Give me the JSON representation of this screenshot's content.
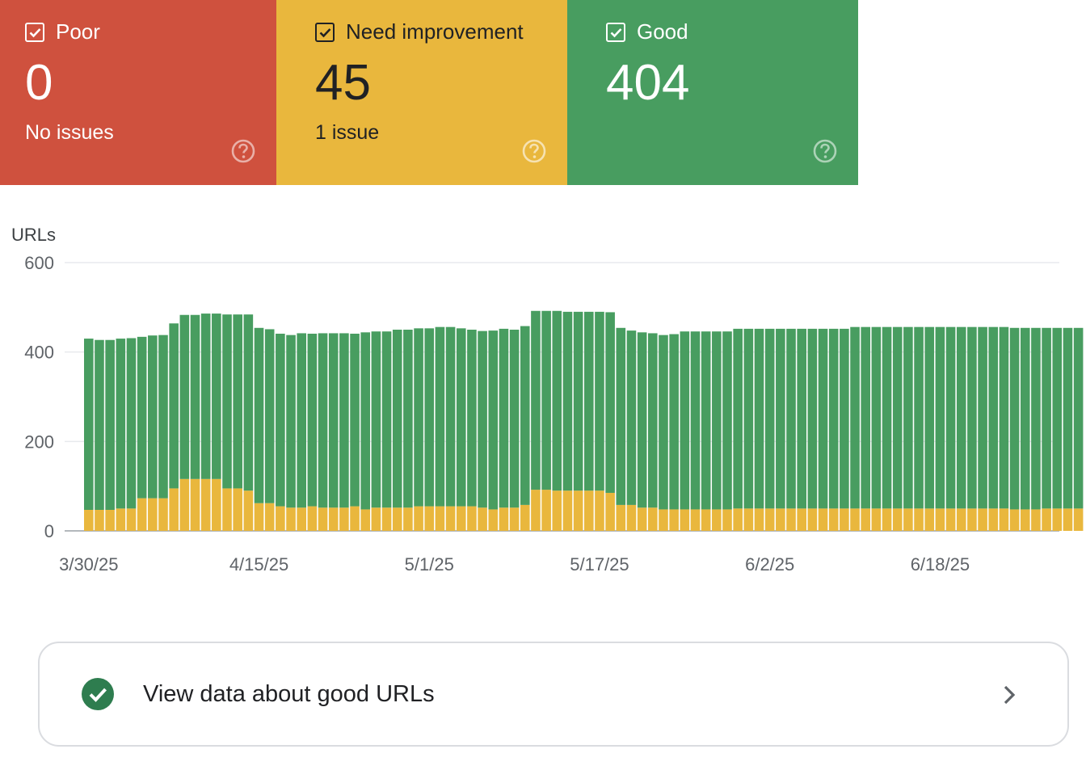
{
  "cards": {
    "poor": {
      "label": "Poor",
      "value": "0",
      "sub": "No issues",
      "color": "#cf513e"
    },
    "need_improvement": {
      "label": "Need improvement",
      "value": "45",
      "sub": "1 issue",
      "color": "#e9b73d"
    },
    "good": {
      "label": "Good",
      "value": "404",
      "sub": "",
      "color": "#489d60"
    }
  },
  "chart_data": {
    "type": "bar",
    "stacked": true,
    "ylabel": "URLs",
    "ylim": [
      0,
      600
    ],
    "yticks": [
      0,
      200,
      400,
      600
    ],
    "xtick_labels": [
      "3/30/25",
      "4/15/25",
      "5/1/25",
      "5/17/25",
      "6/2/25",
      "6/18/25"
    ],
    "xtick_index": [
      0,
      16,
      32,
      48,
      64,
      80
    ],
    "grid": true,
    "legend": "none",
    "series": [
      {
        "name": "Need improvement",
        "color": "#e9b73d",
        "values": [
          47,
          47,
          47,
          50,
          50,
          73,
          73,
          73,
          95,
          116,
          116,
          116,
          116,
          95,
          95,
          90,
          62,
          62,
          55,
          52,
          52,
          55,
          52,
          52,
          52,
          55,
          48,
          52,
          52,
          52,
          52,
          55,
          55,
          55,
          55,
          55,
          55,
          52,
          48,
          52,
          52,
          58,
          92,
          92,
          90,
          90,
          90,
          90,
          90,
          85,
          58,
          58,
          52,
          52,
          48,
          48,
          48,
          48,
          48,
          48,
          48,
          50,
          50,
          50,
          50,
          50,
          50,
          50,
          50,
          50,
          50,
          50,
          50,
          50,
          50,
          50,
          50,
          50,
          50,
          50,
          50,
          50,
          50,
          50,
          50,
          50,
          50,
          48,
          48,
          48,
          50,
          50,
          50,
          50
        ]
      },
      {
        "name": "Good",
        "color": "#489d60",
        "values": [
          383,
          380,
          380,
          380,
          381,
          361,
          364,
          365,
          369,
          367,
          367,
          370,
          370,
          389,
          389,
          394,
          392,
          389,
          386,
          386,
          390,
          386,
          390,
          390,
          390,
          386,
          396,
          394,
          394,
          398,
          398,
          398,
          398,
          401,
          401,
          398,
          395,
          395,
          400,
          400,
          398,
          400,
          400,
          400,
          402,
          400,
          400,
          400,
          400,
          404,
          396,
          390,
          392,
          390,
          390,
          392,
          398,
          398,
          398,
          398,
          398,
          402,
          402,
          402,
          402,
          402,
          402,
          402,
          402,
          402,
          402,
          402,
          406,
          406,
          406,
          406,
          406,
          406,
          406,
          406,
          406,
          406,
          406,
          406,
          406,
          406,
          406,
          406,
          406,
          406,
          404,
          404,
          404,
          404
        ]
      }
    ]
  },
  "good_link": {
    "text": "View data about good URLs"
  }
}
